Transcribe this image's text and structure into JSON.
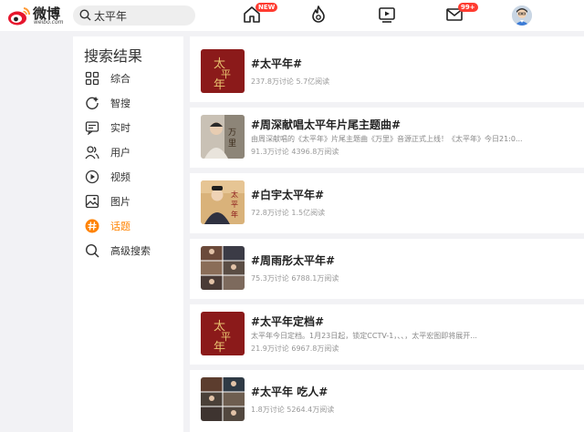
{
  "header": {
    "logo_text": "微博",
    "logo_sub": "weibo.com",
    "search_value": "太平年",
    "home_badge": "NEW",
    "mail_badge": "99+"
  },
  "sidebar": {
    "title": "搜索结果",
    "items": [
      {
        "label": "综合",
        "icon": "grid-icon",
        "active": false
      },
      {
        "label": "智搜",
        "icon": "smart-search-icon",
        "active": false
      },
      {
        "label": "实时",
        "icon": "realtime-icon",
        "active": false
      },
      {
        "label": "用户",
        "icon": "user-icon",
        "active": false
      },
      {
        "label": "视频",
        "icon": "video-icon",
        "active": false
      },
      {
        "label": "图片",
        "icon": "image-icon",
        "active": false
      },
      {
        "label": "话题",
        "icon": "topic-icon",
        "active": true
      },
      {
        "label": "高级搜索",
        "icon": "advanced-search-icon",
        "active": false
      }
    ]
  },
  "topics": [
    {
      "title": "#太平年#",
      "desc": "",
      "stats": "237.8万讨论 5.7亿阅读"
    },
    {
      "title": "#周深献唱太平年片尾主题曲#",
      "desc": "由周深献唱的《太平年》片尾主题曲《万里》音源正式上线！《太平年》今日21:0...",
      "stats": "91.3万讨论 4396.8万阅读"
    },
    {
      "title": "#白宇太平年#",
      "desc": "",
      "stats": "72.8万讨论 1.5亿阅读"
    },
    {
      "title": "#周雨彤太平年#",
      "desc": "",
      "stats": "75.3万讨论 6788.1万阅读"
    },
    {
      "title": "#太平年定档#",
      "desc": "太平年今日定档。1月23日起，锁定CCTV-1，、、，太平宏图即将展开...",
      "stats": "21.9万讨论 6967.8万阅读"
    },
    {
      "title": "#太平年 吃人#",
      "desc": "",
      "stats": "1.8万讨论 5264.4万阅读"
    }
  ],
  "colors": {
    "accent": "#ff8200",
    "badge": "#ff3b30",
    "poster_red": "#8b1a1a"
  }
}
